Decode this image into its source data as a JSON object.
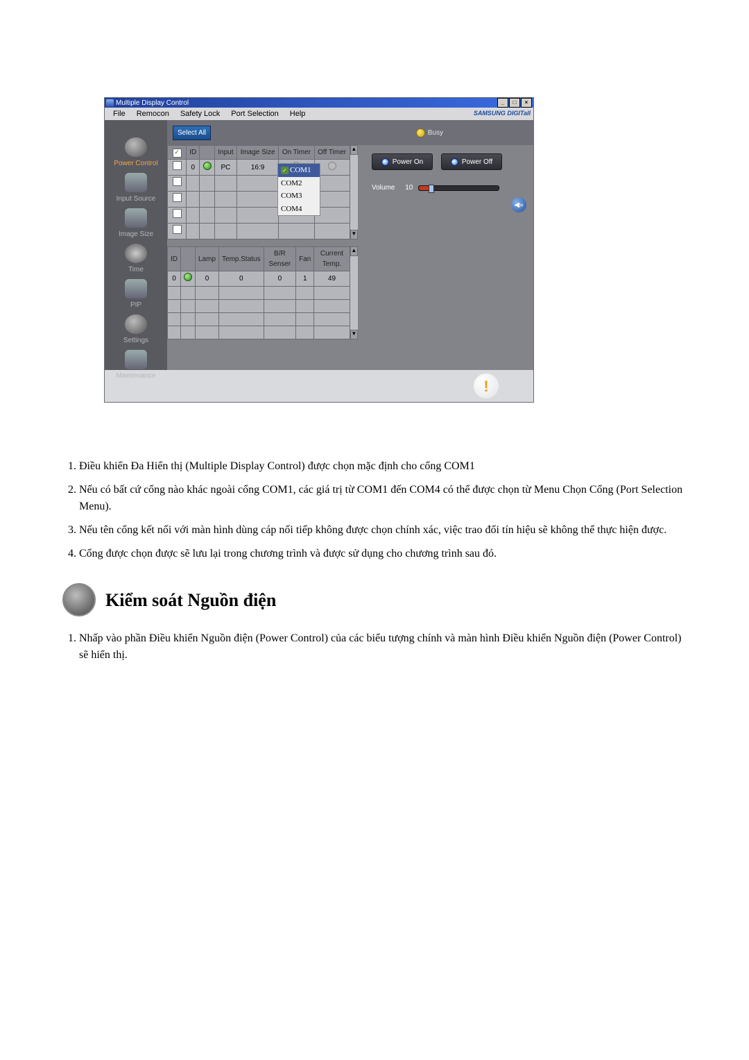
{
  "window": {
    "title": "Multiple Display Control",
    "brand": "SAMSUNG DIGITall"
  },
  "menubar": {
    "file": "File",
    "remocon": "Remocon",
    "safety_lock": "Safety Lock",
    "port_selection": "Port Selection",
    "help": "Help"
  },
  "port_dropdown": {
    "com1": "COM1",
    "com2": "COM2",
    "com3": "COM3",
    "com4": "COM4"
  },
  "sidebar": {
    "power_control": "Power Control",
    "input_source": "Input Source",
    "image_size": "Image Size",
    "time": "Time",
    "pip": "PIP",
    "settings": "Settings",
    "maintenance": "Maintenance"
  },
  "topstrip": {
    "select_all": "Select All",
    "busy": "Busy"
  },
  "grid_top": {
    "headers": {
      "id": "ID",
      "input": "Input",
      "image_size": "Image Size",
      "on_timer": "On Timer",
      "off_timer": "Off Timer"
    },
    "row0": {
      "id": "0",
      "input": "PC",
      "image_size": "16:9"
    }
  },
  "grid_bottom": {
    "headers": {
      "id": "ID",
      "lamp": "Lamp",
      "temp_status": "Temp.Status",
      "br_sensor": "B/R Senser",
      "fan": "Fan",
      "current_temp": "Current Temp."
    },
    "row0": {
      "id": "0",
      "lamp": "0",
      "temp_status": "0",
      "br_sensor": "0",
      "fan": "1",
      "current_temp": "49"
    }
  },
  "power_panel": {
    "power_on": "Power On",
    "power_off": "Power Off",
    "volume_label": "Volume",
    "volume_value": "10"
  },
  "notes": {
    "n1": "Điều khiển Đa Hiển thị (Multiple Display Control) được chọn mặc định cho cổng COM1",
    "n2": "Nếu có bất cứ cổng nào khác ngoài cổng COM1, các giá trị từ COM1 đến COM4 có thể được chọn từ Menu Chọn Cổng (Port Selection Menu).",
    "n3": "Nếu tên cổng kết nối với màn hình dùng cáp nối tiếp không được chọn chính xác, việc trao đổi tín hiệu sẽ không thể thực hiện được.",
    "n4": "Cổng được chọn được sẽ lưu lại trong chương trình và được sử dụng cho chương trình sau đó."
  },
  "section2": {
    "title": "Kiểm soát Nguồn điện",
    "intro_1": "Nhấp vào phần Điều khiển Nguồn điện (Power Control) của các biểu tượng chính và màn hình Điều khiển Nguồn điện (Power Control) sẽ hiển thị."
  }
}
